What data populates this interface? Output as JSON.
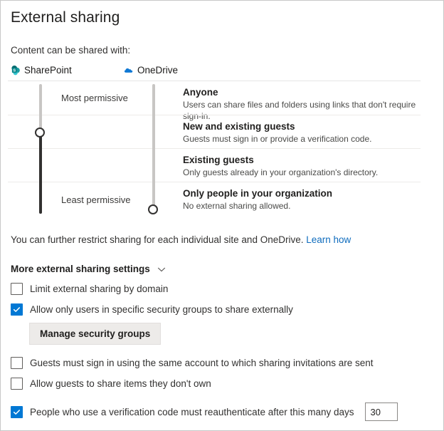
{
  "page": {
    "title": "External sharing",
    "section_label": "Content can be shared with:"
  },
  "services": [
    {
      "name": "SharePoint",
      "icon": "sharepoint-icon",
      "color": "#038387"
    },
    {
      "name": "OneDrive",
      "icon": "onedrive-icon",
      "color": "#0f78d4"
    }
  ],
  "slider": {
    "most_permissive_label": "Most permissive",
    "least_permissive_label": "Least permissive",
    "sharepoint_selected": "New and existing guests",
    "onedrive_selected": "Only people in your organization"
  },
  "levels": [
    {
      "title": "Anyone",
      "description": "Users can share files and folders using links that don't require sign-in."
    },
    {
      "title": "New and existing guests",
      "description": "Guests must sign in or provide a verification code."
    },
    {
      "title": "Existing guests",
      "description": "Only guests already in your organization's directory."
    },
    {
      "title": "Only people in your organization",
      "description": "No external sharing allowed."
    }
  ],
  "restrict": {
    "text": "You can further restrict sharing for each individual site and OneDrive.",
    "link_label": "Learn how",
    "link_color": "#0f6cbd"
  },
  "more_settings": {
    "label": "More external sharing settings",
    "chevron_icon": "chevron-down-icon"
  },
  "checkboxes": [
    {
      "label": "Limit external sharing by domain",
      "checked": false
    },
    {
      "label": "Allow only users in specific security groups to share externally",
      "checked": true
    },
    {
      "label": "Guests must sign in using the same account to which sharing invitations are sent",
      "checked": false
    },
    {
      "label": "Allow guests to share items they don't own",
      "checked": false
    },
    {
      "label": "People who use a verification code must reauthenticate after this many days",
      "checked": true
    }
  ],
  "manage_button": {
    "label": "Manage security groups"
  },
  "days_field": {
    "value": "30",
    "placeholder": ""
  },
  "accent_color": "#0078d4"
}
